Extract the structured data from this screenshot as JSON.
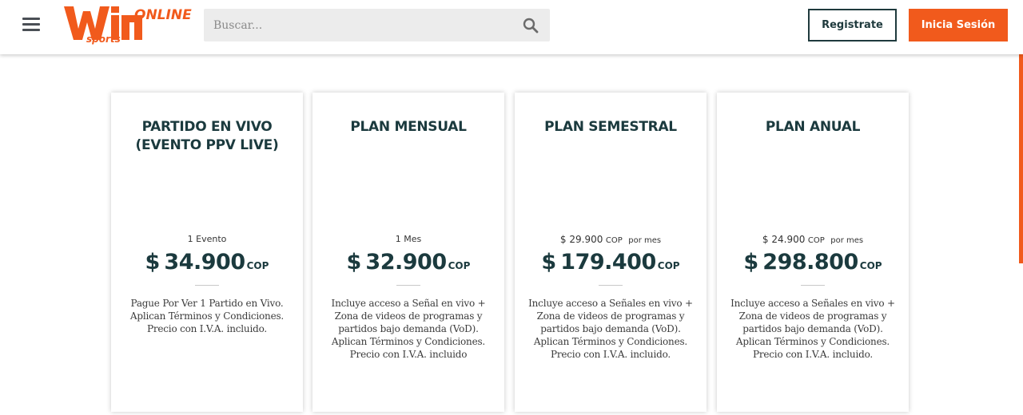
{
  "header": {
    "logo_text": "Win sports ONLINE",
    "search_placeholder": "Buscar...",
    "register_label": "Registrate",
    "login_label": "Inicia Sesión"
  },
  "colors": {
    "brand_orange": "#f15a1c",
    "dark_teal": "#1b3a3e"
  },
  "plans": [
    {
      "title_line1": "PARTIDO EN VIVO",
      "title_line2": "(EVENTO PPV LIVE)",
      "sub_prefix": "",
      "sub_text": "1 Evento",
      "sub_suffix": "",
      "currency": "$",
      "price": "34.900",
      "price_currency": "COP",
      "desc_lines": [
        "Pague Por Ver 1 Partido en Vivo.",
        "Aplican Términos y Condiciones.",
        "Precio con I.V.A. incluido."
      ]
    },
    {
      "title_line1": "PLAN MENSUAL",
      "title_line2": "",
      "sub_prefix": "",
      "sub_text": "1 Mes",
      "sub_suffix": "",
      "currency": "$",
      "price": "32.900",
      "price_currency": "COP",
      "desc_lines": [
        "Incluye acceso a Señal en vivo +",
        "Zona de videos de programas y",
        "partidos bajo demanda (VoD).",
        "Aplican Términos y Condiciones.",
        "Precio con I.V.A. incluido"
      ]
    },
    {
      "title_line1": "PLAN SEMESTRAL",
      "title_line2": "",
      "sub_prefix": "$ 29.900",
      "sub_text": "COP",
      "sub_suffix": "por mes",
      "currency": "$",
      "price": "179.400",
      "price_currency": "COP",
      "desc_lines": [
        "Incluye acceso a Señales en vivo +",
        "Zona de videos de programas y",
        "partidos bajo demanda (VoD).",
        "Aplican Términos y Condiciones.",
        "Precio con I.V.A. incluido."
      ]
    },
    {
      "title_line1": "PLAN ANUAL",
      "title_line2": "",
      "sub_prefix": "$ 24.900",
      "sub_text": "COP",
      "sub_suffix": "por mes",
      "currency": "$",
      "price": "298.800",
      "price_currency": "COP",
      "desc_lines": [
        "Incluye acceso a Señales en vivo +",
        "Zona de videos de programas y",
        "partidos bajo demanda (VoD).",
        "Aplican Términos y Condiciones.",
        "Precio con I.V.A. incluido."
      ]
    }
  ]
}
